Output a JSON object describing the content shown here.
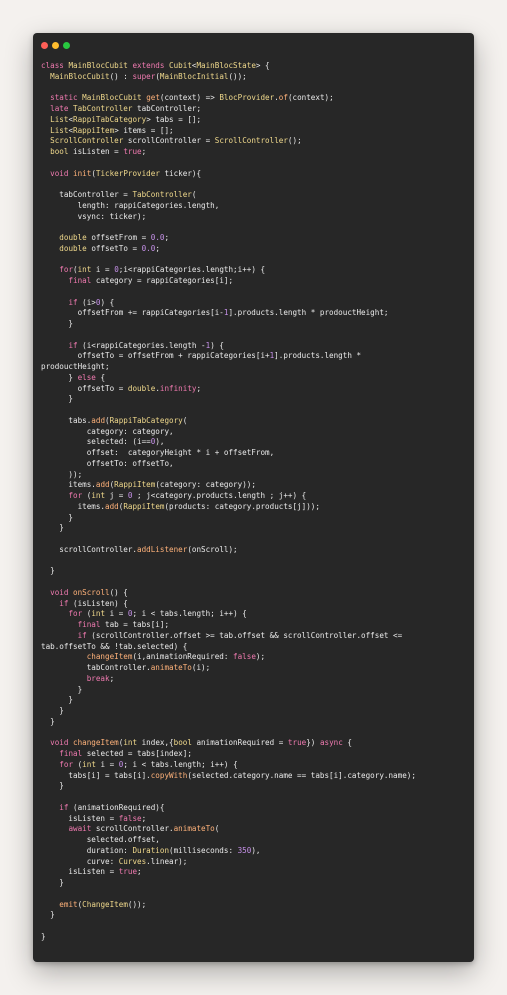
{
  "window": {
    "controls": {
      "close_color": "#fe5f57",
      "minimize_color": "#febc2e",
      "maximize_color": "#28c840"
    }
  },
  "theme": {
    "background": "#272727",
    "keyword": "#f07ab0",
    "type": "#f0d98c",
    "function": "#ffb27a",
    "literal": "#c792ea",
    "plain": "#eaeaea"
  },
  "code_lines": [
    [
      [
        "kw",
        "class "
      ],
      [
        "ty",
        "MainBlocCubit "
      ],
      [
        "kw",
        "extends "
      ],
      [
        "ty",
        "Cubit"
      ],
      [
        "pl",
        "<"
      ],
      [
        "ty",
        "MainBlocState"
      ],
      [
        "pl",
        "> {"
      ]
    ],
    [
      [
        "pl",
        "  "
      ],
      [
        "ty",
        "MainBlocCubit"
      ],
      [
        "pl",
        "() : "
      ],
      [
        "kw",
        "super"
      ],
      [
        "pl",
        "("
      ],
      [
        "ty",
        "MainBlocInitial"
      ],
      [
        "pl",
        "());"
      ]
    ],
    [],
    [
      [
        "pl",
        "  "
      ],
      [
        "kw",
        "static "
      ],
      [
        "ty",
        "MainBlocCubit "
      ],
      [
        "fn",
        "get"
      ],
      [
        "pl",
        "(context) => "
      ],
      [
        "ty",
        "BlocProvider"
      ],
      [
        "pl",
        "."
      ],
      [
        "fn",
        "of"
      ],
      [
        "pl",
        "(context);"
      ]
    ],
    [
      [
        "pl",
        "  "
      ],
      [
        "kw",
        "late "
      ],
      [
        "ty",
        "TabController "
      ],
      [
        "pl",
        "tabController;"
      ]
    ],
    [
      [
        "pl",
        "  "
      ],
      [
        "ty",
        "List"
      ],
      [
        "pl",
        "<"
      ],
      [
        "ty",
        "RappiTabCategory"
      ],
      [
        "pl",
        "> tabs = [];"
      ]
    ],
    [
      [
        "pl",
        "  "
      ],
      [
        "ty",
        "List"
      ],
      [
        "pl",
        "<"
      ],
      [
        "ty",
        "RappiItem"
      ],
      [
        "pl",
        "> items = [];"
      ]
    ],
    [
      [
        "pl",
        "  "
      ],
      [
        "ty",
        "ScrollController "
      ],
      [
        "pl",
        "scrollController = "
      ],
      [
        "ty",
        "ScrollController"
      ],
      [
        "pl",
        "();"
      ]
    ],
    [
      [
        "pl",
        "  "
      ],
      [
        "ty",
        "bool "
      ],
      [
        "pl",
        "isListen = "
      ],
      [
        "kw",
        "true"
      ],
      [
        "pl",
        ";"
      ]
    ],
    [],
    [
      [
        "pl",
        "  "
      ],
      [
        "kw",
        "void "
      ],
      [
        "fn",
        "init"
      ],
      [
        "pl",
        "("
      ],
      [
        "ty",
        "TickerProvider "
      ],
      [
        "pl",
        "ticker){"
      ]
    ],
    [],
    [
      [
        "pl",
        "    tabController = "
      ],
      [
        "ty",
        "TabController"
      ],
      [
        "pl",
        "("
      ]
    ],
    [
      [
        "pl",
        "        length: rappiCategories.length,"
      ]
    ],
    [
      [
        "pl",
        "        vsync: ticker);"
      ]
    ],
    [],
    [
      [
        "pl",
        "    "
      ],
      [
        "ty",
        "double "
      ],
      [
        "pl",
        "offsetFrom = "
      ],
      [
        "nu",
        "0.0"
      ],
      [
        "pl",
        ";"
      ]
    ],
    [
      [
        "pl",
        "    "
      ],
      [
        "ty",
        "double "
      ],
      [
        "pl",
        "offsetTo = "
      ],
      [
        "nu",
        "0.0"
      ],
      [
        "pl",
        ";"
      ]
    ],
    [],
    [
      [
        "pl",
        "    "
      ],
      [
        "kw",
        "for"
      ],
      [
        "pl",
        "("
      ],
      [
        "ty",
        "int "
      ],
      [
        "pl",
        "i = "
      ],
      [
        "nu",
        "0"
      ],
      [
        "pl",
        ";i<rappiCategories.length;i++) {"
      ]
    ],
    [
      [
        "pl",
        "      "
      ],
      [
        "kw",
        "final "
      ],
      [
        "pl",
        "category = rappiCategories[i];"
      ]
    ],
    [],
    [
      [
        "pl",
        "      "
      ],
      [
        "kw",
        "if "
      ],
      [
        "pl",
        "(i>"
      ],
      [
        "nu",
        "0"
      ],
      [
        "pl",
        ") {"
      ]
    ],
    [
      [
        "pl",
        "        offsetFrom += rappiCategories[i-"
      ],
      [
        "nu",
        "1"
      ],
      [
        "pl",
        "].products.length * prodouctHeight;"
      ]
    ],
    [
      [
        "pl",
        "      }"
      ]
    ],
    [],
    [
      [
        "pl",
        "      "
      ],
      [
        "kw",
        "if "
      ],
      [
        "pl",
        "(i<rappiCategories.length -"
      ],
      [
        "nu",
        "1"
      ],
      [
        "pl",
        ") {"
      ]
    ],
    [
      [
        "pl",
        "        offsetTo = offsetFrom + rappiCategories[i+"
      ],
      [
        "nu",
        "1"
      ],
      [
        "pl",
        "].products.length *"
      ]
    ],
    [
      [
        "pl",
        "prodouctHeight;"
      ]
    ],
    [
      [
        "pl",
        "      } "
      ],
      [
        "kw",
        "else "
      ],
      [
        "pl",
        "{"
      ]
    ],
    [
      [
        "pl",
        "        offsetTo = "
      ],
      [
        "ty",
        "double"
      ],
      [
        "pl",
        "."
      ],
      [
        "kw",
        "infinity"
      ],
      [
        "pl",
        ";"
      ]
    ],
    [
      [
        "pl",
        "      }"
      ]
    ],
    [],
    [
      [
        "pl",
        "      tabs."
      ],
      [
        "fn",
        "add"
      ],
      [
        "pl",
        "("
      ],
      [
        "ty",
        "RappiTabCategory"
      ],
      [
        "pl",
        "("
      ]
    ],
    [
      [
        "pl",
        "          category: category,"
      ]
    ],
    [
      [
        "pl",
        "          selected: (i=="
      ],
      [
        "nu",
        "0"
      ],
      [
        "pl",
        "),"
      ]
    ],
    [
      [
        "pl",
        "          offset:  categoryHeight * i + offsetFrom,"
      ]
    ],
    [
      [
        "pl",
        "          offsetTo: offsetTo,"
      ]
    ],
    [
      [
        "pl",
        "      ));"
      ]
    ],
    [
      [
        "pl",
        "      items."
      ],
      [
        "fn",
        "add"
      ],
      [
        "pl",
        "("
      ],
      [
        "ty",
        "RappiItem"
      ],
      [
        "pl",
        "(category: category));"
      ]
    ],
    [
      [
        "pl",
        "      "
      ],
      [
        "kw",
        "for "
      ],
      [
        "pl",
        "("
      ],
      [
        "ty",
        "int "
      ],
      [
        "pl",
        "j = "
      ],
      [
        "nu",
        "0"
      ],
      [
        "pl",
        " ; j<category.products.length ; j++) {"
      ]
    ],
    [
      [
        "pl",
        "        items."
      ],
      [
        "fn",
        "add"
      ],
      [
        "pl",
        "("
      ],
      [
        "ty",
        "RappiItem"
      ],
      [
        "pl",
        "(products: category.products[j]));"
      ]
    ],
    [
      [
        "pl",
        "      }"
      ]
    ],
    [
      [
        "pl",
        "    }"
      ]
    ],
    [],
    [
      [
        "pl",
        "    scrollController."
      ],
      [
        "fn",
        "addListener"
      ],
      [
        "pl",
        "(onScroll);"
      ]
    ],
    [],
    [
      [
        "pl",
        "  }"
      ]
    ],
    [],
    [
      [
        "pl",
        "  "
      ],
      [
        "kw",
        "void "
      ],
      [
        "fn",
        "onScroll"
      ],
      [
        "pl",
        "() {"
      ]
    ],
    [
      [
        "pl",
        "    "
      ],
      [
        "kw",
        "if "
      ],
      [
        "pl",
        "(isListen) {"
      ]
    ],
    [
      [
        "pl",
        "      "
      ],
      [
        "kw",
        "for "
      ],
      [
        "pl",
        "("
      ],
      [
        "ty",
        "int "
      ],
      [
        "pl",
        "i = "
      ],
      [
        "nu",
        "0"
      ],
      [
        "pl",
        "; i < tabs.length; i++) {"
      ]
    ],
    [
      [
        "pl",
        "        "
      ],
      [
        "kw",
        "final "
      ],
      [
        "pl",
        "tab = tabs[i];"
      ]
    ],
    [
      [
        "pl",
        "        "
      ],
      [
        "kw",
        "if "
      ],
      [
        "pl",
        "(scrollController.offset >= tab.offset && scrollController.offset <="
      ]
    ],
    [
      [
        "pl",
        "tab.offsetTo && !tab.selected) {"
      ]
    ],
    [
      [
        "pl",
        "          "
      ],
      [
        "fn",
        "changeItem"
      ],
      [
        "pl",
        "(i,animationRequired: "
      ],
      [
        "kw",
        "false"
      ],
      [
        "pl",
        ");"
      ]
    ],
    [
      [
        "pl",
        "          tabController."
      ],
      [
        "fn",
        "animateTo"
      ],
      [
        "pl",
        "(i);"
      ]
    ],
    [
      [
        "pl",
        "          "
      ],
      [
        "kw",
        "break"
      ],
      [
        "pl",
        ";"
      ]
    ],
    [
      [
        "pl",
        "        }"
      ]
    ],
    [
      [
        "pl",
        "      }"
      ]
    ],
    [
      [
        "pl",
        "    }"
      ]
    ],
    [
      [
        "pl",
        "  }"
      ]
    ],
    [],
    [
      [
        "pl",
        "  "
      ],
      [
        "kw",
        "void "
      ],
      [
        "fn",
        "changeItem"
      ],
      [
        "pl",
        "("
      ],
      [
        "ty",
        "int "
      ],
      [
        "pl",
        "index,{"
      ],
      [
        "ty",
        "bool "
      ],
      [
        "pl",
        "animationRequired = "
      ],
      [
        "kw",
        "true"
      ],
      [
        "pl",
        "}) "
      ],
      [
        "kw",
        "async "
      ],
      [
        "pl",
        "{"
      ]
    ],
    [
      [
        "pl",
        "    "
      ],
      [
        "kw",
        "final "
      ],
      [
        "pl",
        "selected = tabs[index];"
      ]
    ],
    [
      [
        "pl",
        "    "
      ],
      [
        "kw",
        "for "
      ],
      [
        "pl",
        "("
      ],
      [
        "ty",
        "int "
      ],
      [
        "pl",
        "i = "
      ],
      [
        "nu",
        "0"
      ],
      [
        "pl",
        "; i < tabs.length; i++) {"
      ]
    ],
    [
      [
        "pl",
        "      tabs[i] = tabs[i]."
      ],
      [
        "fn",
        "copyWith"
      ],
      [
        "pl",
        "(selected.category.name == tabs[i].category.name);"
      ]
    ],
    [
      [
        "pl",
        "    }"
      ]
    ],
    [],
    [
      [
        "pl",
        "    "
      ],
      [
        "kw",
        "if "
      ],
      [
        "pl",
        "(animationRequired){"
      ]
    ],
    [
      [
        "pl",
        "      isListen = "
      ],
      [
        "kw",
        "false"
      ],
      [
        "pl",
        ";"
      ]
    ],
    [
      [
        "pl",
        "      "
      ],
      [
        "kw",
        "await "
      ],
      [
        "pl",
        "scrollController."
      ],
      [
        "fn",
        "animateTo"
      ],
      [
        "pl",
        "("
      ]
    ],
    [
      [
        "pl",
        "          selected.offset,"
      ]
    ],
    [
      [
        "pl",
        "          duration: "
      ],
      [
        "ty",
        "Duration"
      ],
      [
        "pl",
        "(milliseconds: "
      ],
      [
        "nu",
        "350"
      ],
      [
        "pl",
        "),"
      ]
    ],
    [
      [
        "pl",
        "          curve: "
      ],
      [
        "ty",
        "Curves"
      ],
      [
        "pl",
        ".linear);"
      ]
    ],
    [
      [
        "pl",
        "      isListen = "
      ],
      [
        "kw",
        "true"
      ],
      [
        "pl",
        ";"
      ]
    ],
    [
      [
        "pl",
        "    }"
      ]
    ],
    [],
    [
      [
        "pl",
        "    "
      ],
      [
        "fn",
        "emit"
      ],
      [
        "pl",
        "("
      ],
      [
        "ty",
        "ChangeItem"
      ],
      [
        "pl",
        "());"
      ]
    ],
    [
      [
        "pl",
        "  }"
      ]
    ],
    [],
    [
      [
        "pl",
        "}"
      ]
    ]
  ]
}
